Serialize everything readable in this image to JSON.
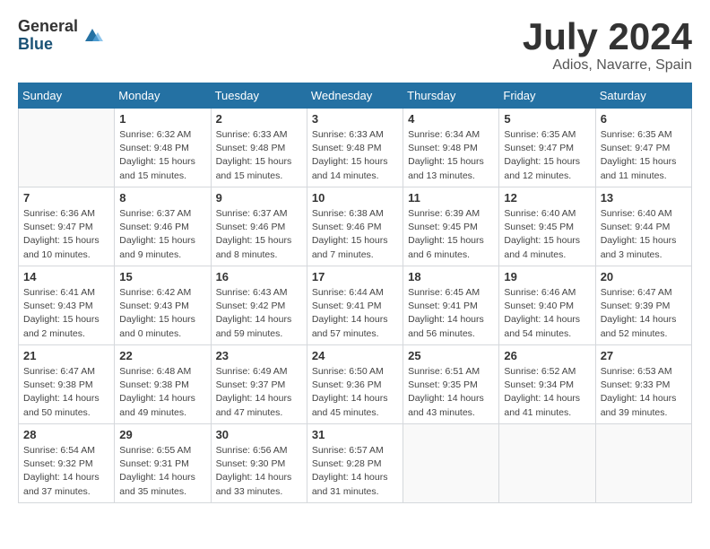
{
  "logo": {
    "general": "General",
    "blue": "Blue"
  },
  "title": "July 2024",
  "location": "Adios, Navarre, Spain",
  "days_header": [
    "Sunday",
    "Monday",
    "Tuesday",
    "Wednesday",
    "Thursday",
    "Friday",
    "Saturday"
  ],
  "weeks": [
    [
      {
        "day": "",
        "info": ""
      },
      {
        "day": "1",
        "info": "Sunrise: 6:32 AM\nSunset: 9:48 PM\nDaylight: 15 hours\nand 15 minutes."
      },
      {
        "day": "2",
        "info": "Sunrise: 6:33 AM\nSunset: 9:48 PM\nDaylight: 15 hours\nand 15 minutes."
      },
      {
        "day": "3",
        "info": "Sunrise: 6:33 AM\nSunset: 9:48 PM\nDaylight: 15 hours\nand 14 minutes."
      },
      {
        "day": "4",
        "info": "Sunrise: 6:34 AM\nSunset: 9:48 PM\nDaylight: 15 hours\nand 13 minutes."
      },
      {
        "day": "5",
        "info": "Sunrise: 6:35 AM\nSunset: 9:47 PM\nDaylight: 15 hours\nand 12 minutes."
      },
      {
        "day": "6",
        "info": "Sunrise: 6:35 AM\nSunset: 9:47 PM\nDaylight: 15 hours\nand 11 minutes."
      }
    ],
    [
      {
        "day": "7",
        "info": "Sunrise: 6:36 AM\nSunset: 9:47 PM\nDaylight: 15 hours\nand 10 minutes."
      },
      {
        "day": "8",
        "info": "Sunrise: 6:37 AM\nSunset: 9:46 PM\nDaylight: 15 hours\nand 9 minutes."
      },
      {
        "day": "9",
        "info": "Sunrise: 6:37 AM\nSunset: 9:46 PM\nDaylight: 15 hours\nand 8 minutes."
      },
      {
        "day": "10",
        "info": "Sunrise: 6:38 AM\nSunset: 9:46 PM\nDaylight: 15 hours\nand 7 minutes."
      },
      {
        "day": "11",
        "info": "Sunrise: 6:39 AM\nSunset: 9:45 PM\nDaylight: 15 hours\nand 6 minutes."
      },
      {
        "day": "12",
        "info": "Sunrise: 6:40 AM\nSunset: 9:45 PM\nDaylight: 15 hours\nand 4 minutes."
      },
      {
        "day": "13",
        "info": "Sunrise: 6:40 AM\nSunset: 9:44 PM\nDaylight: 15 hours\nand 3 minutes."
      }
    ],
    [
      {
        "day": "14",
        "info": "Sunrise: 6:41 AM\nSunset: 9:43 PM\nDaylight: 15 hours\nand 2 minutes."
      },
      {
        "day": "15",
        "info": "Sunrise: 6:42 AM\nSunset: 9:43 PM\nDaylight: 15 hours\nand 0 minutes."
      },
      {
        "day": "16",
        "info": "Sunrise: 6:43 AM\nSunset: 9:42 PM\nDaylight: 14 hours\nand 59 minutes."
      },
      {
        "day": "17",
        "info": "Sunrise: 6:44 AM\nSunset: 9:41 PM\nDaylight: 14 hours\nand 57 minutes."
      },
      {
        "day": "18",
        "info": "Sunrise: 6:45 AM\nSunset: 9:41 PM\nDaylight: 14 hours\nand 56 minutes."
      },
      {
        "day": "19",
        "info": "Sunrise: 6:46 AM\nSunset: 9:40 PM\nDaylight: 14 hours\nand 54 minutes."
      },
      {
        "day": "20",
        "info": "Sunrise: 6:47 AM\nSunset: 9:39 PM\nDaylight: 14 hours\nand 52 minutes."
      }
    ],
    [
      {
        "day": "21",
        "info": "Sunrise: 6:47 AM\nSunset: 9:38 PM\nDaylight: 14 hours\nand 50 minutes."
      },
      {
        "day": "22",
        "info": "Sunrise: 6:48 AM\nSunset: 9:38 PM\nDaylight: 14 hours\nand 49 minutes."
      },
      {
        "day": "23",
        "info": "Sunrise: 6:49 AM\nSunset: 9:37 PM\nDaylight: 14 hours\nand 47 minutes."
      },
      {
        "day": "24",
        "info": "Sunrise: 6:50 AM\nSunset: 9:36 PM\nDaylight: 14 hours\nand 45 minutes."
      },
      {
        "day": "25",
        "info": "Sunrise: 6:51 AM\nSunset: 9:35 PM\nDaylight: 14 hours\nand 43 minutes."
      },
      {
        "day": "26",
        "info": "Sunrise: 6:52 AM\nSunset: 9:34 PM\nDaylight: 14 hours\nand 41 minutes."
      },
      {
        "day": "27",
        "info": "Sunrise: 6:53 AM\nSunset: 9:33 PM\nDaylight: 14 hours\nand 39 minutes."
      }
    ],
    [
      {
        "day": "28",
        "info": "Sunrise: 6:54 AM\nSunset: 9:32 PM\nDaylight: 14 hours\nand 37 minutes."
      },
      {
        "day": "29",
        "info": "Sunrise: 6:55 AM\nSunset: 9:31 PM\nDaylight: 14 hours\nand 35 minutes."
      },
      {
        "day": "30",
        "info": "Sunrise: 6:56 AM\nSunset: 9:30 PM\nDaylight: 14 hours\nand 33 minutes."
      },
      {
        "day": "31",
        "info": "Sunrise: 6:57 AM\nSunset: 9:28 PM\nDaylight: 14 hours\nand 31 minutes."
      },
      {
        "day": "",
        "info": ""
      },
      {
        "day": "",
        "info": ""
      },
      {
        "day": "",
        "info": ""
      }
    ]
  ]
}
